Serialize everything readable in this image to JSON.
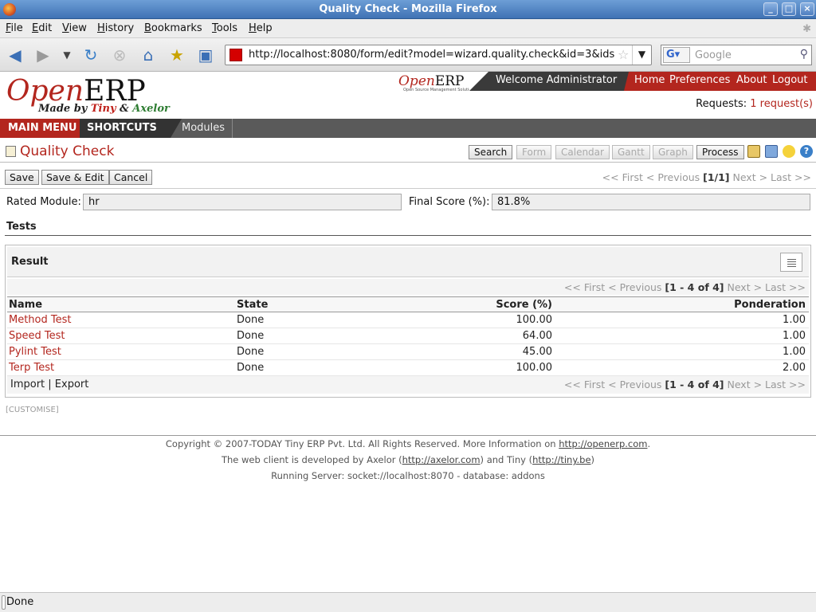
{
  "window": {
    "title": "Quality Check - Mozilla Firefox"
  },
  "menubar": {
    "items": [
      {
        "label": "File",
        "u": "F",
        "rest": "ile"
      },
      {
        "label": "Edit",
        "u": "E",
        "rest": "dit"
      },
      {
        "label": "View",
        "u": "V",
        "rest": "iew"
      },
      {
        "label": "History",
        "u": "H",
        "rest": "istory"
      },
      {
        "label": "Bookmarks",
        "u": "B",
        "rest": "ookmarks"
      },
      {
        "label": "Tools",
        "u": "T",
        "rest": "ools"
      },
      {
        "label": "Help",
        "u": "H",
        "rest": "elp"
      }
    ]
  },
  "browser": {
    "url": "http://localhost:8080/form/edit?model=wizard.quality.check&id=3&ids=",
    "search_placeholder": "Google",
    "search_engine": "G"
  },
  "erp_header": {
    "logo_open": "Open",
    "logo_erp": "ERP",
    "logo_made_by": "Made by ",
    "logo_tiny": "Tiny",
    "logo_and": " & ",
    "logo_axelor": "Axelor",
    "small_logo_open": "Open",
    "small_logo_erp": "ERP",
    "small_tagline": "Open Source Management Solution",
    "welcome": "Welcome Administrator",
    "nav": [
      "Home",
      "Preferences",
      "About",
      "Logout"
    ],
    "requests_label": "Requests:",
    "requests_link": "1 request(s)"
  },
  "mainbar": {
    "main_menu": "MAIN MENU",
    "shortcuts": "SHORTCUTS",
    "modules": "Modules"
  },
  "form": {
    "title": "Quality Check",
    "view_buttons": {
      "search": "Search",
      "form": "Form",
      "calendar": "Calendar",
      "gantt": "Gantt",
      "graph": "Graph",
      "process": "Process"
    },
    "actions": {
      "save": "Save",
      "save_edit": "Save & Edit",
      "cancel": "Cancel"
    },
    "pager": {
      "prefix": "<< First < Previous ",
      "count": "[1/1]",
      "suffix": " Next > Last >>"
    },
    "rated_module_label": "Rated Module:",
    "rated_module_value": "hr",
    "final_score_label": "Final Score (%):",
    "final_score_value": "81.8%",
    "tests_title": "Tests"
  },
  "grid": {
    "title": "Result",
    "pager": {
      "prefix": "<< First < Previous ",
      "count": "[1 - 4 of 4]",
      "suffix": " Next > Last >>"
    },
    "columns": {
      "name": "Name",
      "state": "State",
      "score": "Score (%)",
      "ponderation": "Ponderation"
    },
    "rows": [
      {
        "name": "Method Test",
        "state": "Done",
        "score": "100.00",
        "ponderation": "1.00"
      },
      {
        "name": "Speed Test",
        "state": "Done",
        "score": "64.00",
        "ponderation": "1.00"
      },
      {
        "name": "Pylint Test",
        "state": "Done",
        "score": "45.00",
        "ponderation": "1.00"
      },
      {
        "name": "Terp Test",
        "state": "Done",
        "score": "100.00",
        "ponderation": "2.00"
      }
    ],
    "import_export": "Import | Export"
  },
  "customise": "[CUSTOMISE]",
  "footer": {
    "line1_text": "Copyright © 2007-TODAY Tiny ERP Pvt. Ltd. All Rights Reserved. More Information on ",
    "line1_link": "http://openerp.com",
    "line1_end": ".",
    "line2_a": "The web client is developed by Axelor (",
    "line2_link1": "http://axelor.com",
    "line2_b": ") and Tiny (",
    "line2_link2": "http://tiny.be",
    "line2_c": ")",
    "line3": "Running Server: socket://localhost:8070 - database: addons"
  },
  "status": "Done"
}
